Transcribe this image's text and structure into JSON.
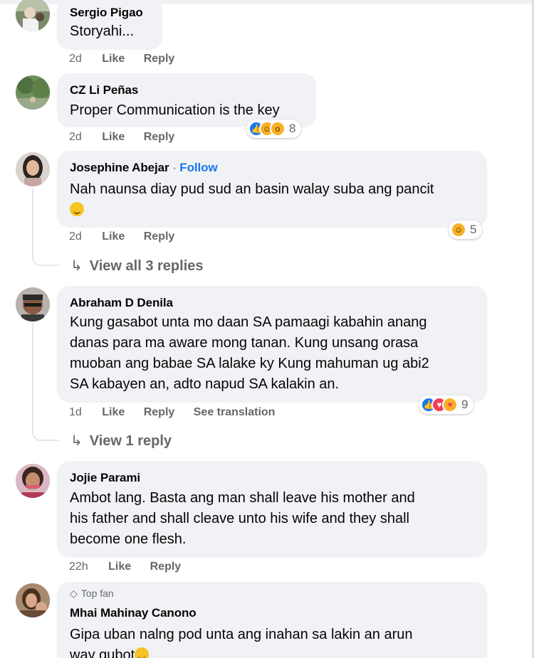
{
  "comments": [
    {
      "name": "Sergio Pigao",
      "text": "Storyahi...",
      "time": "2d",
      "like": "Like",
      "reply": "Reply"
    },
    {
      "name": "CZ Li Peñas",
      "text": "Proper Communication is the key",
      "time": "2d",
      "like": "Like",
      "reply": "Reply",
      "reactions": [
        "like-icon",
        "haha-icon",
        "wow-icon"
      ],
      "reaction_count": "8"
    },
    {
      "name": "Josephine Abejar",
      "separator": "·",
      "follow": "Follow",
      "text": "Nah naunsa diay pud sud an basin walay suba ang pancit",
      "text_emoji": "smiling-face-emoji",
      "time": "2d",
      "like": "Like",
      "reply": "Reply",
      "reactions": [
        "haha-icon"
      ],
      "reaction_count": "5",
      "view_replies": "View all 3 replies"
    },
    {
      "name": "Abraham D Denila",
      "text_lines": [
        "Kung gasabot unta mo daan SA pamaagi kabahin anang",
        "danas para ma aware mong tanan. Kung unsang orasa",
        "muoban ang babae SA lalake ky Kung mahuman ug abi2",
        "SA kabayen an, adto napud SA kalakin an."
      ],
      "time": "1d",
      "like": "Like",
      "reply": "Reply",
      "translate": "See translation",
      "reactions": [
        "like-icon",
        "love-icon",
        "care-icon"
      ],
      "reaction_count": "9",
      "view_replies": "View 1 reply"
    },
    {
      "name": "Jojie Parami",
      "text_lines": [
        "Ambot lang. Basta ang man shall leave his mother and",
        "his father and shall cleave unto his wife and they shall",
        "become one flesh."
      ],
      "time": "22h",
      "like": "Like",
      "reply": "Reply"
    },
    {
      "badge": "Top fan",
      "name": "Mhai Mahinay Canono",
      "text_lines": [
        "Gipa uban nalng pod unta ang inahan sa lakin an arun",
        "way gubot"
      ],
      "text_emoji": "laughing-face-emoji"
    }
  ],
  "colors": {
    "bubble": "#f0f2f5",
    "link": "#1877f2",
    "meta": "#65676b",
    "text": "#050505"
  }
}
